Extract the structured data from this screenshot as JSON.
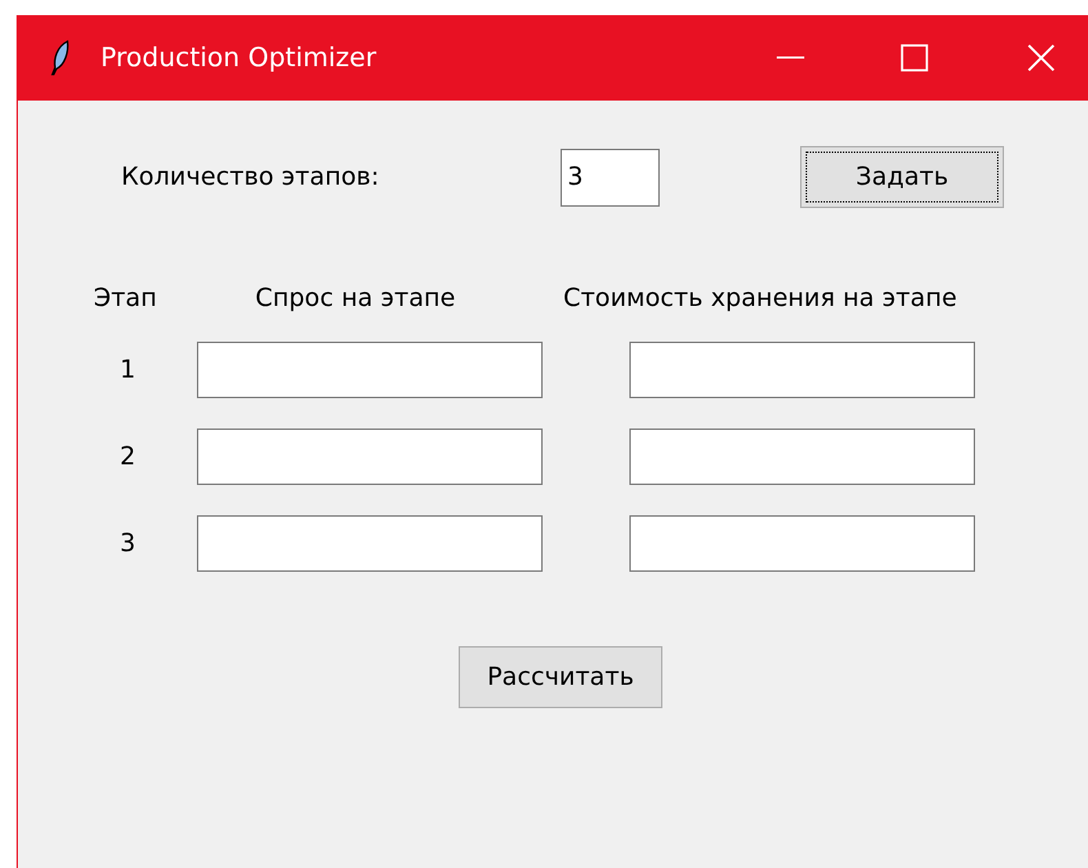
{
  "window": {
    "title": "Production Optimizer"
  },
  "stage_count": {
    "label": "Количество этапов:",
    "value": "3"
  },
  "set_button": {
    "label": "Задать",
    "focused": true
  },
  "table": {
    "columns": [
      "Этап",
      "Спрос на этапе",
      "Стоимость хранения на этапе"
    ],
    "rows": [
      {
        "stage": "1"
      },
      {
        "stage": "2"
      },
      {
        "stage": "3"
      }
    ]
  },
  "calculate_button": {
    "label": "Рассчитать",
    "focused": false
  }
}
